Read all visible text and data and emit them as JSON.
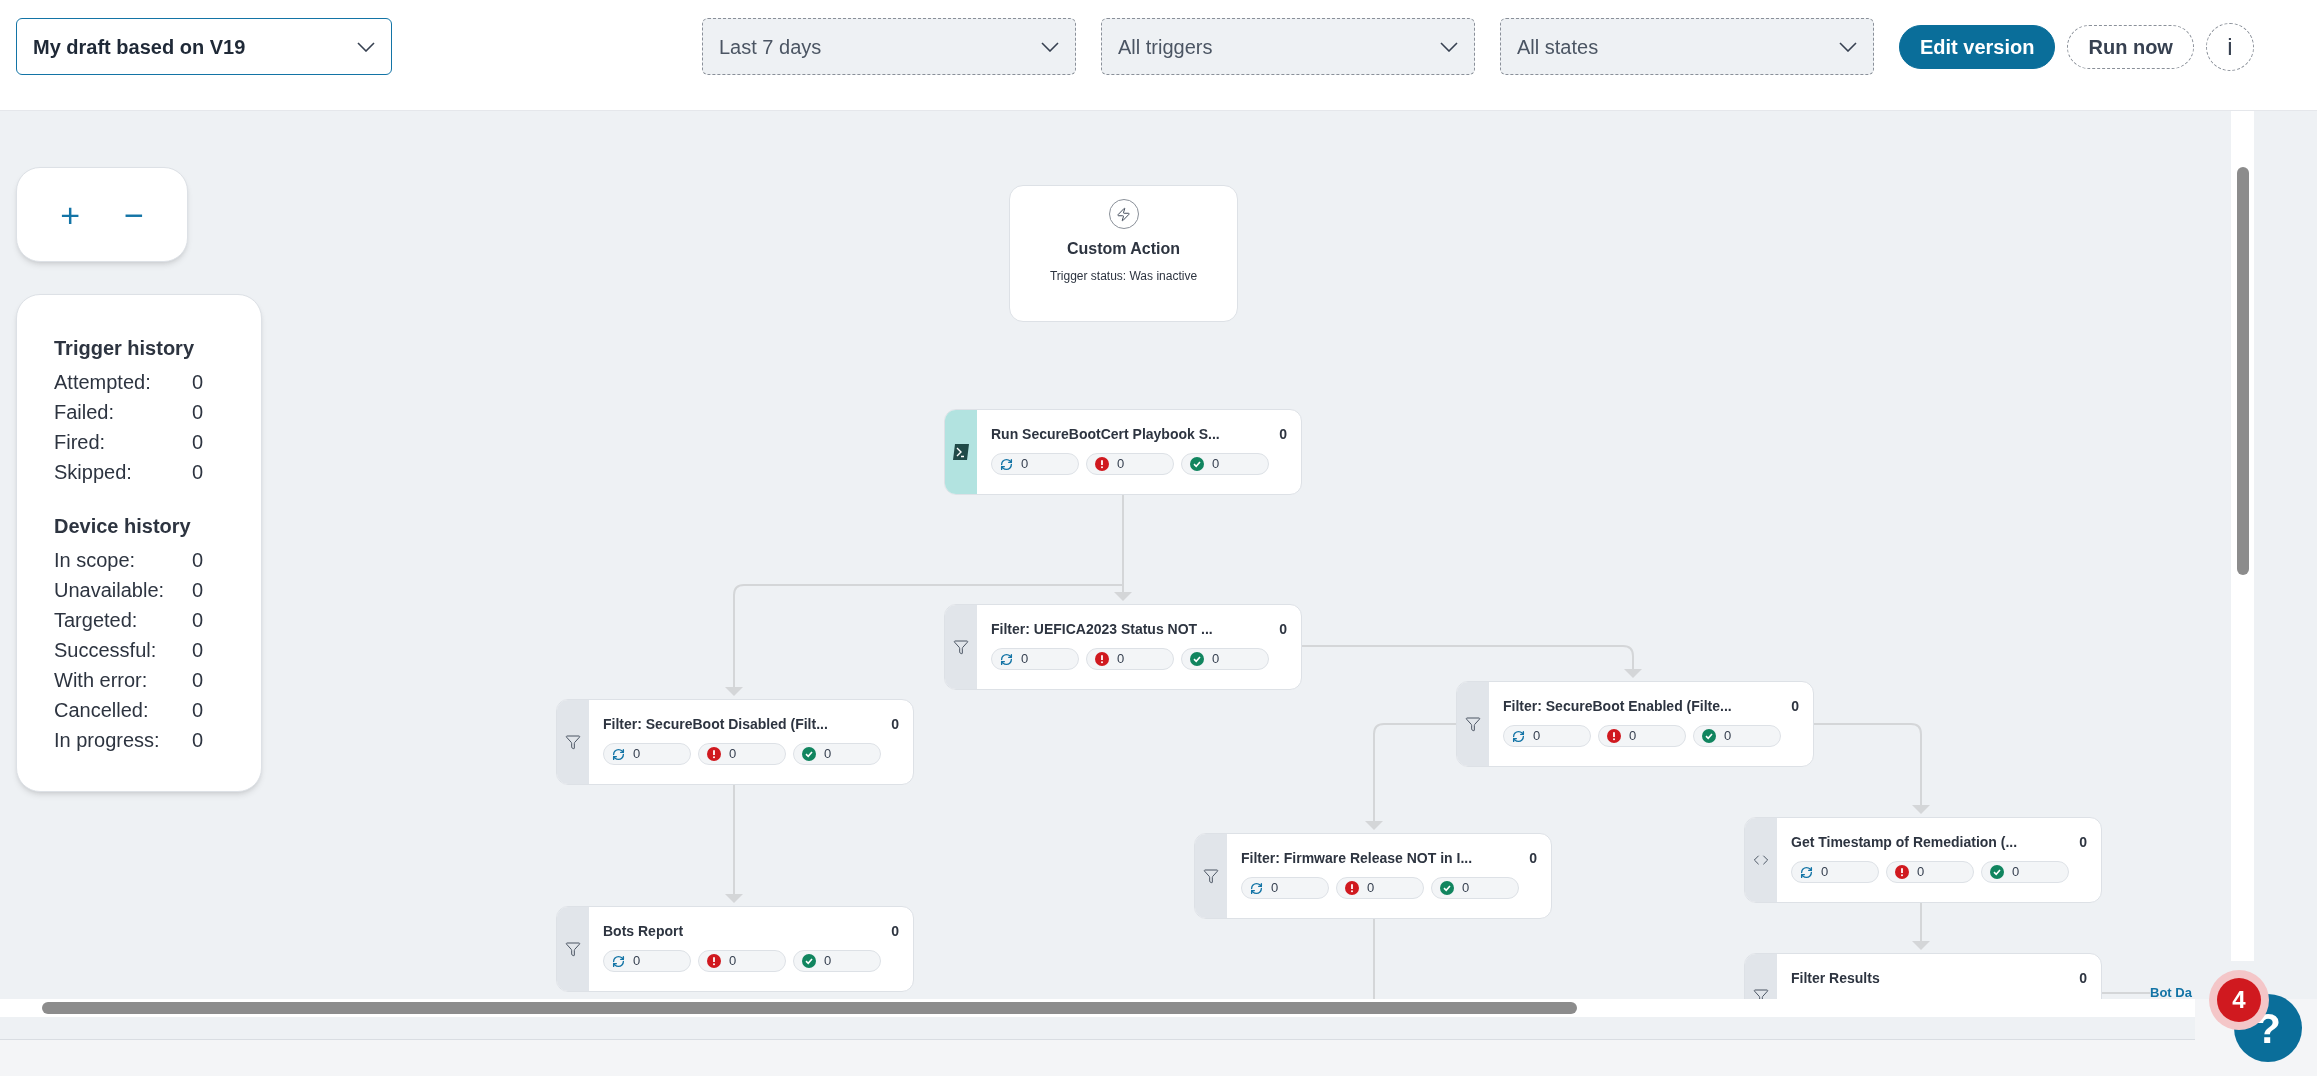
{
  "header": {
    "version_select": "My draft based on V19",
    "filters": [
      {
        "value": "Last 7 days"
      },
      {
        "value": "All triggers"
      },
      {
        "value": "All states"
      }
    ],
    "buttons": [
      {
        "label": "Edit version",
        "kind": "primary"
      },
      {
        "label": "Run now",
        "kind": "secondary"
      }
    ],
    "info_button": "i"
  },
  "zoom_controls": [
    "+",
    "−"
  ],
  "history": [
    {
      "title": "Trigger history",
      "rows": [
        {
          "label": "Attempted:",
          "value": "0"
        },
        {
          "label": "Failed:",
          "value": "0"
        },
        {
          "label": "Fired:",
          "value": "0"
        },
        {
          "label": "Skipped:",
          "value": "0"
        }
      ]
    },
    {
      "title": "Device history",
      "rows": [
        {
          "label": "In scope:",
          "value": "0"
        },
        {
          "label": "Unavailable:",
          "value": "0"
        },
        {
          "label": "Targeted:",
          "value": "0"
        },
        {
          "label": "Successful:",
          "value": "0"
        },
        {
          "label": "With error:",
          "value": "0"
        },
        {
          "label": "Cancelled:",
          "value": "0"
        },
        {
          "label": "In progress:",
          "value": "0"
        }
      ]
    }
  ],
  "trigger_node": {
    "title": "Custom Action",
    "status": "Trigger status: Was inactive"
  },
  "nodes": [
    {
      "kind": "script",
      "title": "Run SecureBootCert Playbook S...",
      "count": "0",
      "stats": {
        "running": "0",
        "failed": "0",
        "succeeded": "0"
      }
    },
    {
      "kind": "filter",
      "title": "Filter: UEFICA2023 Status NOT ...",
      "count": "0",
      "stats": {
        "running": "0",
        "failed": "0",
        "succeeded": "0"
      }
    },
    {
      "kind": "filter",
      "title": "Filter: SecureBoot Disabled (Filt...",
      "count": "0",
      "stats": {
        "running": "0",
        "failed": "0",
        "succeeded": "0"
      }
    },
    {
      "kind": "filter",
      "title": "Filter: SecureBoot Enabled (Filte...",
      "count": "0",
      "stats": {
        "running": "0",
        "failed": "0",
        "succeeded": "0"
      }
    },
    {
      "kind": "filter",
      "title": "Bots Report",
      "count": "0",
      "stats": {
        "running": "0",
        "failed": "0",
        "succeeded": "0"
      }
    },
    {
      "kind": "filter",
      "title": "Filter: Firmware Release NOT in I...",
      "count": "0",
      "stats": {
        "running": "0",
        "failed": "0",
        "succeeded": "0"
      }
    },
    {
      "kind": "code",
      "title": "Get Timestamp of Remediation (...",
      "count": "0",
      "stats": {
        "running": "0",
        "failed": "0",
        "succeeded": "0"
      }
    },
    {
      "kind": "filter",
      "title": "Filter Results",
      "count": "0"
    }
  ],
  "edge_label": "Bot Da",
  "notification_badge": "4",
  "help_button": "?"
}
